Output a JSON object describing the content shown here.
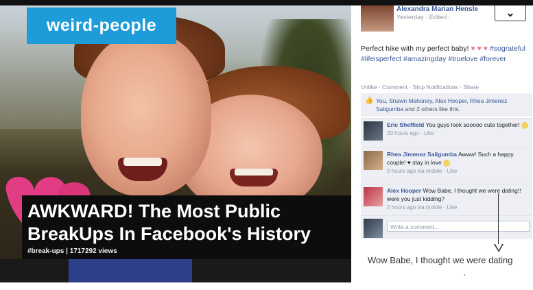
{
  "video": {
    "brand": "weird-people",
    "title": "AWKWARD! The Most Public BreakUps In Facebook's History",
    "meta": "#break-ups | 1717292 views"
  },
  "facebook": {
    "author": "Alexandra Marian Hensle",
    "time": "Yesterday · Edited ·",
    "post_text": "Perfect hike with my perfect baby!",
    "post_hearts": "♥ ♥ ♥",
    "post_tags": "#sograteful #lifeisperfect #amazingday #truelove #forever",
    "actions": "Unlike · Comment · Stop Notifications · Share",
    "likes_names": "You, Shawn Mahoney, Alex Hooper, Rhea Jimenez Saligumba",
    "likes_suffix": "and 2 others like this.",
    "comments": [
      {
        "author": "Eric Sheffield",
        "text": "You guys look sooooo cute together!",
        "meta": "20 hours ago · Like"
      },
      {
        "author": "Rhea Jimenez Saligumba",
        "text": "Awww! Such a happy couple! ♥ stay in love",
        "meta": "9 hours ago via mobile · Like"
      },
      {
        "author": "Alex Hooper",
        "text": "Wow Babe, I thought we were dating!! were you just kidding?",
        "meta": "2 hours ago via mobile · Like"
      }
    ],
    "write_placeholder": "Write a comment...",
    "chevron": "⌄"
  },
  "annotation": {
    "quote": "Wow Babe, I thought we were dating"
  },
  "colors": {
    "brand_blue": "#1e9cd9",
    "fb_link": "#3b5998",
    "caption_bg": "#0d0d0d"
  }
}
